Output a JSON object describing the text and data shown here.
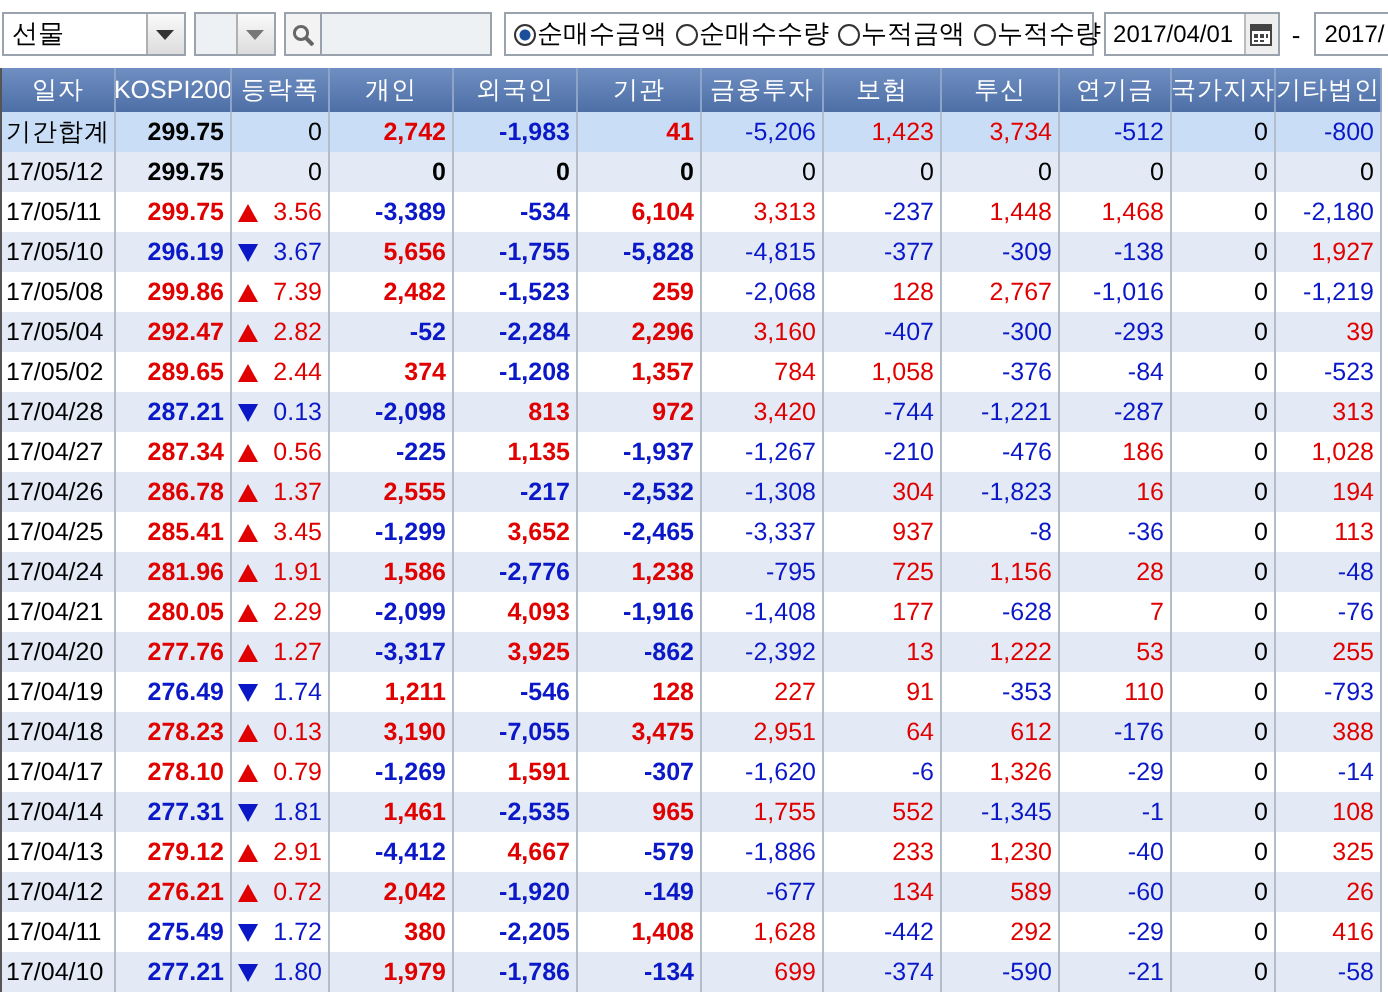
{
  "toolbar": {
    "market": "선물",
    "radios": [
      {
        "label": "순매수금액",
        "selected": true
      },
      {
        "label": "순매수수량",
        "selected": false
      },
      {
        "label": "누적금액",
        "selected": false
      },
      {
        "label": "누적수량",
        "selected": false
      }
    ],
    "date_from": "2017/04/01",
    "separator": "-",
    "date_to": "2017/"
  },
  "table": {
    "columns": [
      "일자",
      "KOSPI200",
      "등락폭",
      "개인",
      "외국인",
      "기관",
      "금융투자",
      "보험",
      "투신",
      "연기금",
      "국가지자",
      "기타법인"
    ],
    "rows": [
      {
        "kind": "total",
        "date": "기간합계",
        "kospi": "299.75",
        "rising": false,
        "falling": false,
        "diff": "0",
        "values": [
          "2,742",
          "-1,983",
          "41",
          "-5,206",
          "1,423",
          "3,734",
          "-512",
          "0",
          "-800"
        ]
      },
      {
        "kind": "day",
        "date": "17/05/12",
        "kospi": "299.75",
        "rising": false,
        "falling": false,
        "diff": "0",
        "values": [
          "0",
          "0",
          "0",
          "0",
          "0",
          "0",
          "0",
          "0",
          "0"
        ]
      },
      {
        "kind": "day",
        "date": "17/05/11",
        "kospi": "299.75",
        "rising": true,
        "falling": false,
        "diff": "3.56",
        "values": [
          "-3,389",
          "-534",
          "6,104",
          "3,313",
          "-237",
          "1,448",
          "1,468",
          "0",
          "-2,180"
        ]
      },
      {
        "kind": "day",
        "date": "17/05/10",
        "kospi": "296.19",
        "rising": false,
        "falling": true,
        "diff": "3.67",
        "values": [
          "5,656",
          "-1,755",
          "-5,828",
          "-4,815",
          "-377",
          "-309",
          "-138",
          "0",
          "1,927"
        ]
      },
      {
        "kind": "day",
        "date": "17/05/08",
        "kospi": "299.86",
        "rising": true,
        "falling": false,
        "diff": "7.39",
        "values": [
          "2,482",
          "-1,523",
          "259",
          "-2,068",
          "128",
          "2,767",
          "-1,016",
          "0",
          "-1,219"
        ]
      },
      {
        "kind": "day",
        "date": "17/05/04",
        "kospi": "292.47",
        "rising": true,
        "falling": false,
        "diff": "2.82",
        "values": [
          "-52",
          "-2,284",
          "2,296",
          "3,160",
          "-407",
          "-300",
          "-293",
          "0",
          "39"
        ]
      },
      {
        "kind": "day",
        "date": "17/05/02",
        "kospi": "289.65",
        "rising": true,
        "falling": false,
        "diff": "2.44",
        "values": [
          "374",
          "-1,208",
          "1,357",
          "784",
          "1,058",
          "-376",
          "-84",
          "0",
          "-523"
        ]
      },
      {
        "kind": "day",
        "date": "17/04/28",
        "kospi": "287.21",
        "rising": false,
        "falling": true,
        "diff": "0.13",
        "values": [
          "-2,098",
          "813",
          "972",
          "3,420",
          "-744",
          "-1,221",
          "-287",
          "0",
          "313"
        ]
      },
      {
        "kind": "day",
        "date": "17/04/27",
        "kospi": "287.34",
        "rising": true,
        "falling": false,
        "diff": "0.56",
        "values": [
          "-225",
          "1,135",
          "-1,937",
          "-1,267",
          "-210",
          "-476",
          "186",
          "0",
          "1,028"
        ]
      },
      {
        "kind": "day",
        "date": "17/04/26",
        "kospi": "286.78",
        "rising": true,
        "falling": false,
        "diff": "1.37",
        "values": [
          "2,555",
          "-217",
          "-2,532",
          "-1,308",
          "304",
          "-1,823",
          "16",
          "0",
          "194"
        ]
      },
      {
        "kind": "day",
        "date": "17/04/25",
        "kospi": "285.41",
        "rising": true,
        "falling": false,
        "diff": "3.45",
        "values": [
          "-1,299",
          "3,652",
          "-2,465",
          "-3,337",
          "937",
          "-8",
          "-36",
          "0",
          "113"
        ]
      },
      {
        "kind": "day",
        "date": "17/04/24",
        "kospi": "281.96",
        "rising": true,
        "falling": false,
        "diff": "1.91",
        "values": [
          "1,586",
          "-2,776",
          "1,238",
          "-795",
          "725",
          "1,156",
          "28",
          "0",
          "-48"
        ]
      },
      {
        "kind": "day",
        "date": "17/04/21",
        "kospi": "280.05",
        "rising": true,
        "falling": false,
        "diff": "2.29",
        "values": [
          "-2,099",
          "4,093",
          "-1,916",
          "-1,408",
          "177",
          "-628",
          "7",
          "0",
          "-76"
        ]
      },
      {
        "kind": "day",
        "date": "17/04/20",
        "kospi": "277.76",
        "rising": true,
        "falling": false,
        "diff": "1.27",
        "values": [
          "-3,317",
          "3,925",
          "-862",
          "-2,392",
          "13",
          "1,222",
          "53",
          "0",
          "255"
        ]
      },
      {
        "kind": "day",
        "date": "17/04/19",
        "kospi": "276.49",
        "rising": false,
        "falling": true,
        "diff": "1.74",
        "values": [
          "1,211",
          "-546",
          "128",
          "227",
          "91",
          "-353",
          "110",
          "0",
          "-793"
        ]
      },
      {
        "kind": "day",
        "date": "17/04/18",
        "kospi": "278.23",
        "rising": true,
        "falling": false,
        "diff": "0.13",
        "values": [
          "3,190",
          "-7,055",
          "3,475",
          "2,951",
          "64",
          "612",
          "-176",
          "0",
          "388"
        ]
      },
      {
        "kind": "day",
        "date": "17/04/17",
        "kospi": "278.10",
        "rising": true,
        "falling": false,
        "diff": "0.79",
        "values": [
          "-1,269",
          "1,591",
          "-307",
          "-1,620",
          "-6",
          "1,326",
          "-29",
          "0",
          "-14"
        ]
      },
      {
        "kind": "day",
        "date": "17/04/14",
        "kospi": "277.31",
        "rising": false,
        "falling": true,
        "diff": "1.81",
        "values": [
          "1,461",
          "-2,535",
          "965",
          "1,755",
          "552",
          "-1,345",
          "-1",
          "0",
          "108"
        ]
      },
      {
        "kind": "day",
        "date": "17/04/13",
        "kospi": "279.12",
        "rising": true,
        "falling": false,
        "diff": "2.91",
        "values": [
          "-4,412",
          "4,667",
          "-579",
          "-1,886",
          "233",
          "1,230",
          "-40",
          "0",
          "325"
        ]
      },
      {
        "kind": "day",
        "date": "17/04/12",
        "kospi": "276.21",
        "rising": true,
        "falling": false,
        "diff": "0.72",
        "values": [
          "2,042",
          "-1,920",
          "-149",
          "-677",
          "134",
          "589",
          "-60",
          "0",
          "26"
        ]
      },
      {
        "kind": "day",
        "date": "17/04/11",
        "kospi": "275.49",
        "rising": false,
        "falling": true,
        "diff": "1.72",
        "values": [
          "380",
          "-2,205",
          "1,408",
          "1,628",
          "-442",
          "292",
          "-29",
          "0",
          "416"
        ]
      },
      {
        "kind": "day",
        "date": "17/04/10",
        "kospi": "277.21",
        "rising": false,
        "falling": true,
        "diff": "1.80",
        "values": [
          "1,979",
          "-1,786",
          "-134",
          "699",
          "-374",
          "-590",
          "-21",
          "0",
          "-58"
        ]
      }
    ]
  }
}
